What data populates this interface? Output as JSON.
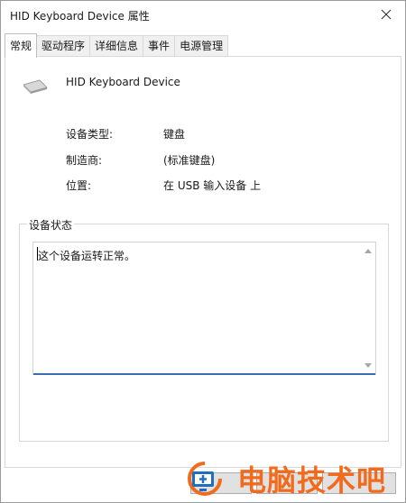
{
  "window": {
    "title": "HID Keyboard Device 属性"
  },
  "tabs": [
    {
      "label": "常规",
      "active": true
    },
    {
      "label": "驱动程序",
      "active": false
    },
    {
      "label": "详细信息",
      "active": false
    },
    {
      "label": "事件",
      "active": false
    },
    {
      "label": "电源管理",
      "active": false
    }
  ],
  "device": {
    "name": "HID Keyboard Device",
    "icon": "keyboard-icon"
  },
  "properties": [
    {
      "label": "设备类型:",
      "value": "键盘"
    },
    {
      "label": "制造商:",
      "value": "(标准键盘)"
    },
    {
      "label": "位置:",
      "value": "在 USB 输入设备 上"
    }
  ],
  "status": {
    "group_title": "设备状态",
    "text": "这个设备运转正常。"
  },
  "watermark": {
    "text": "电脑技术吧",
    "color": "#f26b1d",
    "logo_color": "#1f6fc0"
  },
  "colors": {
    "accent": "#3b6fb0"
  }
}
